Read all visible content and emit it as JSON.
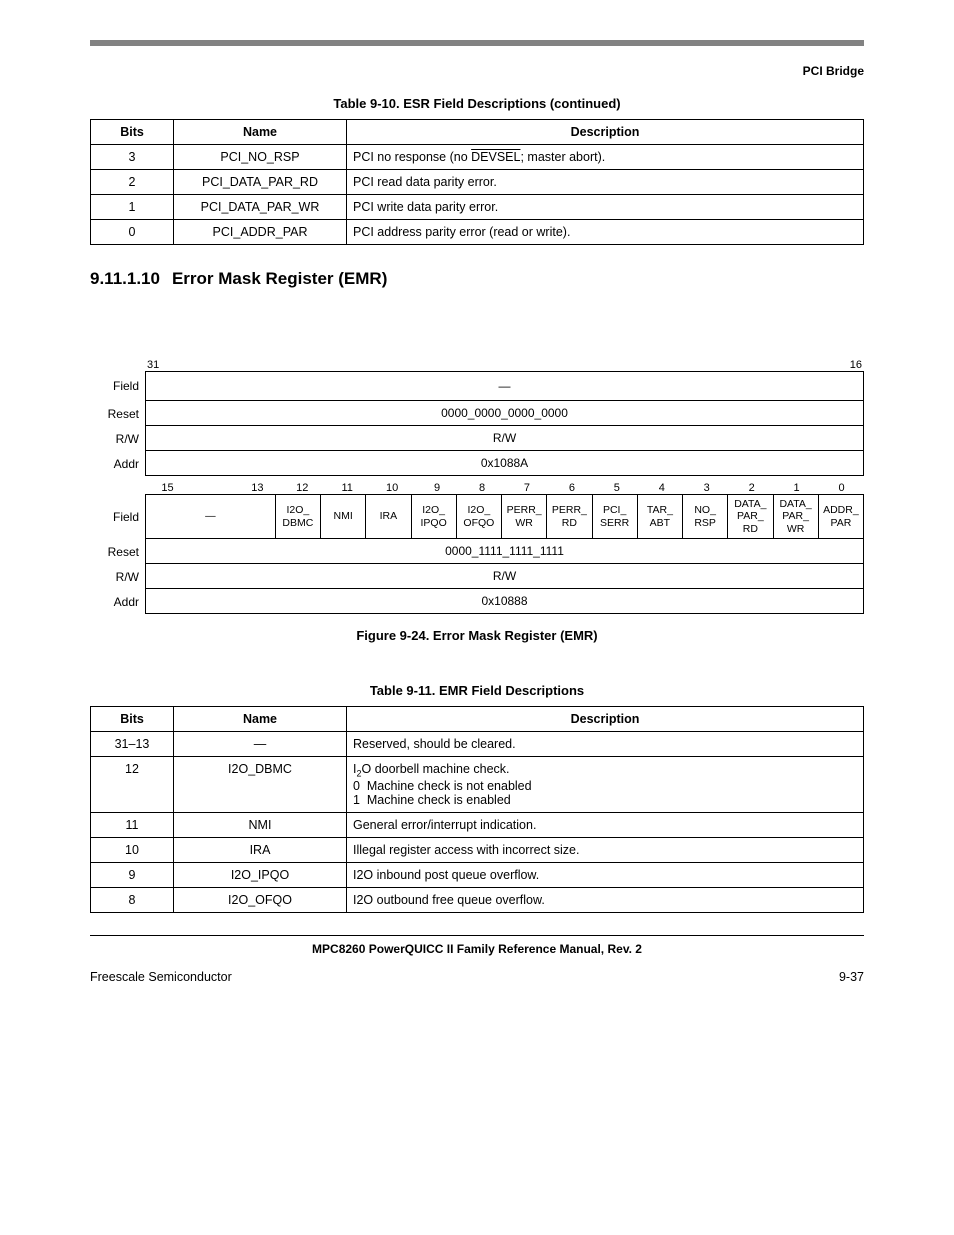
{
  "header": {
    "section": "PCI Bridge"
  },
  "table910": {
    "caption": "Table 9-10. ESR Field Descriptions (continued)",
    "cols": [
      "Bits",
      "Name",
      "Description"
    ],
    "rows": [
      {
        "bits": "3",
        "name": "PCI_NO_RSP",
        "desc_pre": "PCI no response (no ",
        "desc_over": "DEVSEL",
        "desc_post": "; master abort)."
      },
      {
        "bits": "2",
        "name": "PCI_DATA_PAR_RD",
        "desc": "PCI read data parity error."
      },
      {
        "bits": "1",
        "name": "PCI_DATA_PAR_WR",
        "desc": "PCI write data parity error."
      },
      {
        "bits": "0",
        "name": "PCI_ADDR_PAR",
        "desc": "PCI address parity error (read or write)."
      }
    ]
  },
  "heading": {
    "num": "9.11.1.10",
    "title": "Error Mask Register (EMR)"
  },
  "regUpper": {
    "bit_hi": "31",
    "bit_lo": "16",
    "field": "—",
    "reset": "0000_0000_0000_0000",
    "rw": "R/W",
    "addr": "0x1088A"
  },
  "regLowerBits": [
    "15",
    "",
    "13",
    "12",
    "11",
    "10",
    "9",
    "8",
    "7",
    "6",
    "5",
    "4",
    "3",
    "2",
    "1",
    "0"
  ],
  "regLowerFields": [
    {
      "label": "—",
      "span": 3
    },
    {
      "label": "I2O_\nDBMC",
      "span": 1
    },
    {
      "label": "NMI",
      "span": 1
    },
    {
      "label": "IRA",
      "span": 1
    },
    {
      "label": "I2O_\nIPQO",
      "span": 1
    },
    {
      "label": "I2O_\nOFQO",
      "span": 1
    },
    {
      "label": "PERR_\nWR",
      "span": 1
    },
    {
      "label": "PERR_\nRD",
      "span": 1
    },
    {
      "label": "PCI_\nSERR",
      "span": 1
    },
    {
      "label": "TAR_\nABT",
      "span": 1
    },
    {
      "label": "NO_\nRSP",
      "span": 1
    },
    {
      "label": "DATA_\nPAR_\nRD",
      "span": 1
    },
    {
      "label": "DATA_\nPAR_\nWR",
      "span": 1
    },
    {
      "label": "ADDR_\nPAR",
      "span": 1
    }
  ],
  "regLower": {
    "reset": "0000_1111_1111_1111",
    "rw": "R/W",
    "addr": "0x10888"
  },
  "figCaption": "Figure 9-24. Error Mask Register (EMR)",
  "table911": {
    "caption": "Table 9-11. EMR Field Descriptions",
    "cols": [
      "Bits",
      "Name",
      "Description"
    ],
    "rows": [
      {
        "bits": "31–13",
        "name": "—",
        "desc": "Reserved, should be cleared."
      },
      {
        "bits": "12",
        "name": "I2O_DBMC",
        "desc_html": "I<span class='sub'>2</span>O doorbell machine check.<br>0&nbsp;&nbsp;Machine check is not enabled<br>1&nbsp;&nbsp;Machine check is enabled"
      },
      {
        "bits": "11",
        "name": "NMI",
        "desc": "General error/interrupt indication."
      },
      {
        "bits": "10",
        "name": "IRA",
        "desc": "Illegal register access with incorrect size."
      },
      {
        "bits": "9",
        "name": "I2O_IPQO",
        "desc": "I2O inbound post queue overflow."
      },
      {
        "bits": "8",
        "name": "I2O_OFQO",
        "desc": "I2O outbound free queue overflow."
      }
    ]
  },
  "footer": {
    "manual": "MPC8260 PowerQUICC II Family Reference Manual, Rev. 2",
    "left": "Freescale Semiconductor",
    "right": "9-37"
  }
}
